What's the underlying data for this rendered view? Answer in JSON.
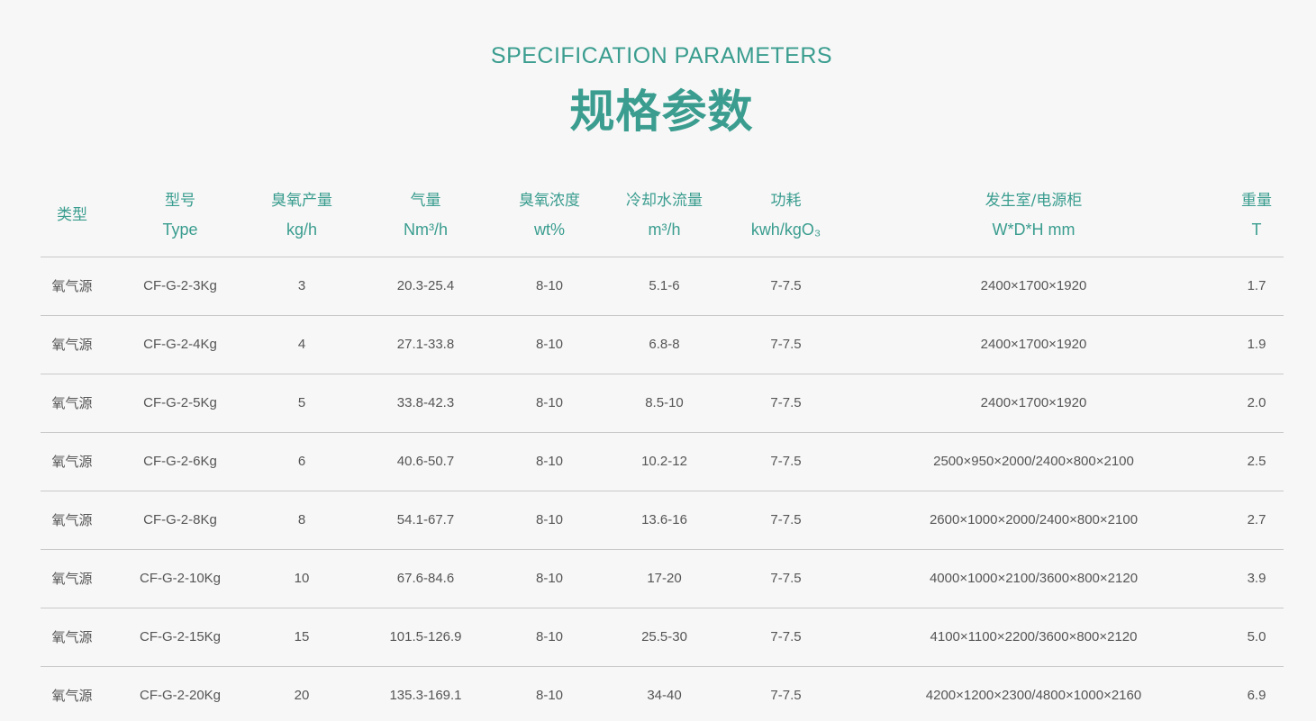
{
  "header": {
    "subtitle_en": "SPECIFICATION PARAMETERS",
    "title_cn": "规格参数"
  },
  "table": {
    "columns": [
      {
        "cn": "类型",
        "en": ""
      },
      {
        "cn": "型号",
        "en": "Type"
      },
      {
        "cn": "臭氧产量",
        "en": "kg/h"
      },
      {
        "cn": "气量",
        "en": "Nm³/h"
      },
      {
        "cn": "臭氧浓度",
        "en": "wt%"
      },
      {
        "cn": "冷却水流量",
        "en": "m³/h"
      },
      {
        "cn": "功耗",
        "en": "kwh/kgO₃"
      },
      {
        "cn": "发生室/电源柜",
        "en": "W*D*H mm"
      },
      {
        "cn": "重量",
        "en": "T"
      }
    ],
    "rows": [
      [
        "氧气源",
        "CF-G-2-3Kg",
        "3",
        "20.3-25.4",
        "8-10",
        "5.1-6",
        "7-7.5",
        "2400×1700×1920",
        "1.7"
      ],
      [
        "氧气源",
        "CF-G-2-4Kg",
        "4",
        "27.1-33.8",
        "8-10",
        "6.8-8",
        "7-7.5",
        "2400×1700×1920",
        "1.9"
      ],
      [
        "氧气源",
        "CF-G-2-5Kg",
        "5",
        "33.8-42.3",
        "8-10",
        "8.5-10",
        "7-7.5",
        "2400×1700×1920",
        "2.0"
      ],
      [
        "氧气源",
        "CF-G-2-6Kg",
        "6",
        "40.6-50.7",
        "8-10",
        "10.2-12",
        "7-7.5",
        "2500×950×2000/2400×800×2100",
        "2.5"
      ],
      [
        "氧气源",
        "CF-G-2-8Kg",
        "8",
        "54.1-67.7",
        "8-10",
        "13.6-16",
        "7-7.5",
        "2600×1000×2000/2400×800×2100",
        "2.7"
      ],
      [
        "氧气源",
        "CF-G-2-10Kg",
        "10",
        "67.6-84.6",
        "8-10",
        "17-20",
        "7-7.5",
        "4000×1000×2100/3600×800×2120",
        "3.9"
      ],
      [
        "氧气源",
        "CF-G-2-15Kg",
        "15",
        "101.5-126.9",
        "8-10",
        "25.5-30",
        "7-7.5",
        "4100×1100×2200/3600×800×2120",
        "5.0"
      ],
      [
        "氧气源",
        "CF-G-2-20Kg",
        "20",
        "135.3-169.1",
        "8-10",
        "34-40",
        "7-7.5",
        "4200×1200×2300/4800×1000×2160",
        "6.9"
      ]
    ]
  },
  "colors": {
    "accent": "#3a9d8f",
    "text": "#555555",
    "divider": "#c9c9c9",
    "background": "#f7f7f7"
  }
}
